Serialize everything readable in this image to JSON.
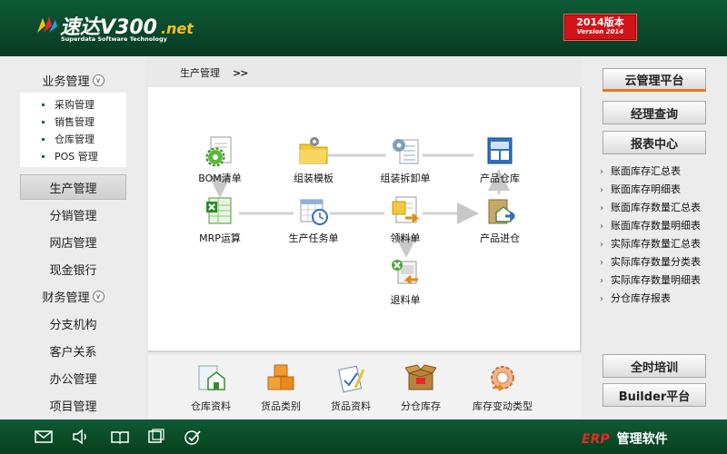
{
  "header": {
    "logo_text": "速达V300",
    "logo_suffix": ".net",
    "logo_sub": "Superdata Software Technology",
    "version": "2014版本",
    "version_sub": "Version 2014"
  },
  "left_nav": {
    "business": "业务管理",
    "business_items": [
      "采购管理",
      "销售管理",
      "仓库管理",
      "POS 管理"
    ],
    "production": "生产管理",
    "distribution": "分销管理",
    "online_store": "网店管理",
    "cash_bank": "现金银行",
    "finance": "财务管理",
    "branches": "分支机构",
    "crm": "客户关系",
    "office": "办公管理",
    "project": "项目管理"
  },
  "breadcrumb": {
    "text": "生产管理",
    "arrows": ">>"
  },
  "flow": {
    "bom": "BOM清单",
    "assembly_template": "组装模板",
    "assembly_disassembly": "组装拆卸单",
    "product_warehouse": "产品仓库",
    "mrp": "MRP运算",
    "production_task": "生产任务单",
    "material_requisition": "领料单",
    "product_inbound": "产品进仓",
    "material_return": "退料单"
  },
  "bottom_items": {
    "warehouse_info": "仓库资料",
    "goods_category": "货品类别",
    "goods_info": "货品资料",
    "branch_stock": "分仓库存",
    "stock_change_type": "库存变动类型"
  },
  "right_panel": {
    "cloud": "云管理平台",
    "manager_query": "经理查询",
    "report_center": "报表中心",
    "reports": [
      "账面库存汇总表",
      "账面库存明细表",
      "账面库存数量汇总表",
      "账面库存数量明细表",
      "实际库存数量汇总表",
      "实际库存数量分类表",
      "实际库存数量明细表",
      "分仓库存报表"
    ],
    "training": "全时培训",
    "builder": "Builder平台"
  },
  "footer": {
    "erp": "ERP",
    "product": "管理软件",
    "icons": [
      "mail-icon",
      "speaker-icon",
      "book-icon",
      "window-icon",
      "check-icon"
    ]
  },
  "colors": {
    "header_green": "#0b4a2c",
    "version_red": "#d1141a",
    "cloud_accent": "#e8761b",
    "erp_red": "#e8262b"
  }
}
